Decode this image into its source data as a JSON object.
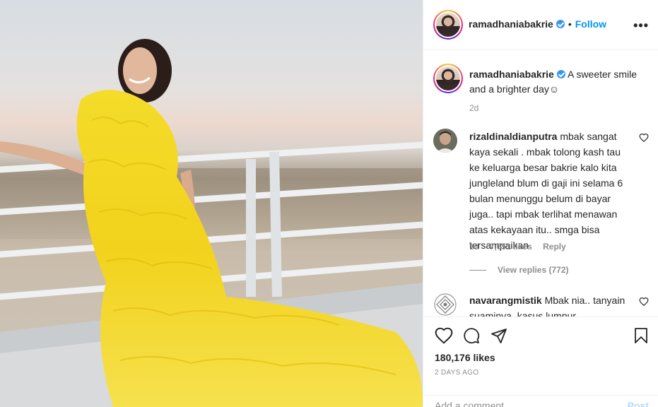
{
  "post": {
    "username": "ramadhaniabakrie",
    "follow_label": "Follow",
    "more_label": "•••",
    "caption": "A sweeter smile and a brighter day☺",
    "caption_time": "2d"
  },
  "comments": [
    {
      "username": "rizaldinaldianputra",
      "text": "mbak sangat kaya sekali . mbak tolong kash tau ke keluarga besar bakrie kalo kita jungleland blum di gaji ini selama 6 bulan menunggu belum di bayar juga.. tapi mbak terlihat menawan atas kekayaan itu.. smga bisa tersampaikan",
      "time": "1d",
      "likes": "7,651 likes",
      "reply_label": "Reply",
      "view_replies": "View replies (772)"
    },
    {
      "username": "navarangmistik",
      "text": "Mbak nia.. tanyain suaminya, kasus lumpur"
    }
  ],
  "stats": {
    "likes": "180,176 likes",
    "posted_ago": "2 DAYS AGO"
  },
  "composer": {
    "placeholder": "Add a comment...",
    "post_label": "Post"
  },
  "colors": {
    "accent": "#0095f6",
    "verified": "#3897f0",
    "muted": "#8e8e8e"
  }
}
